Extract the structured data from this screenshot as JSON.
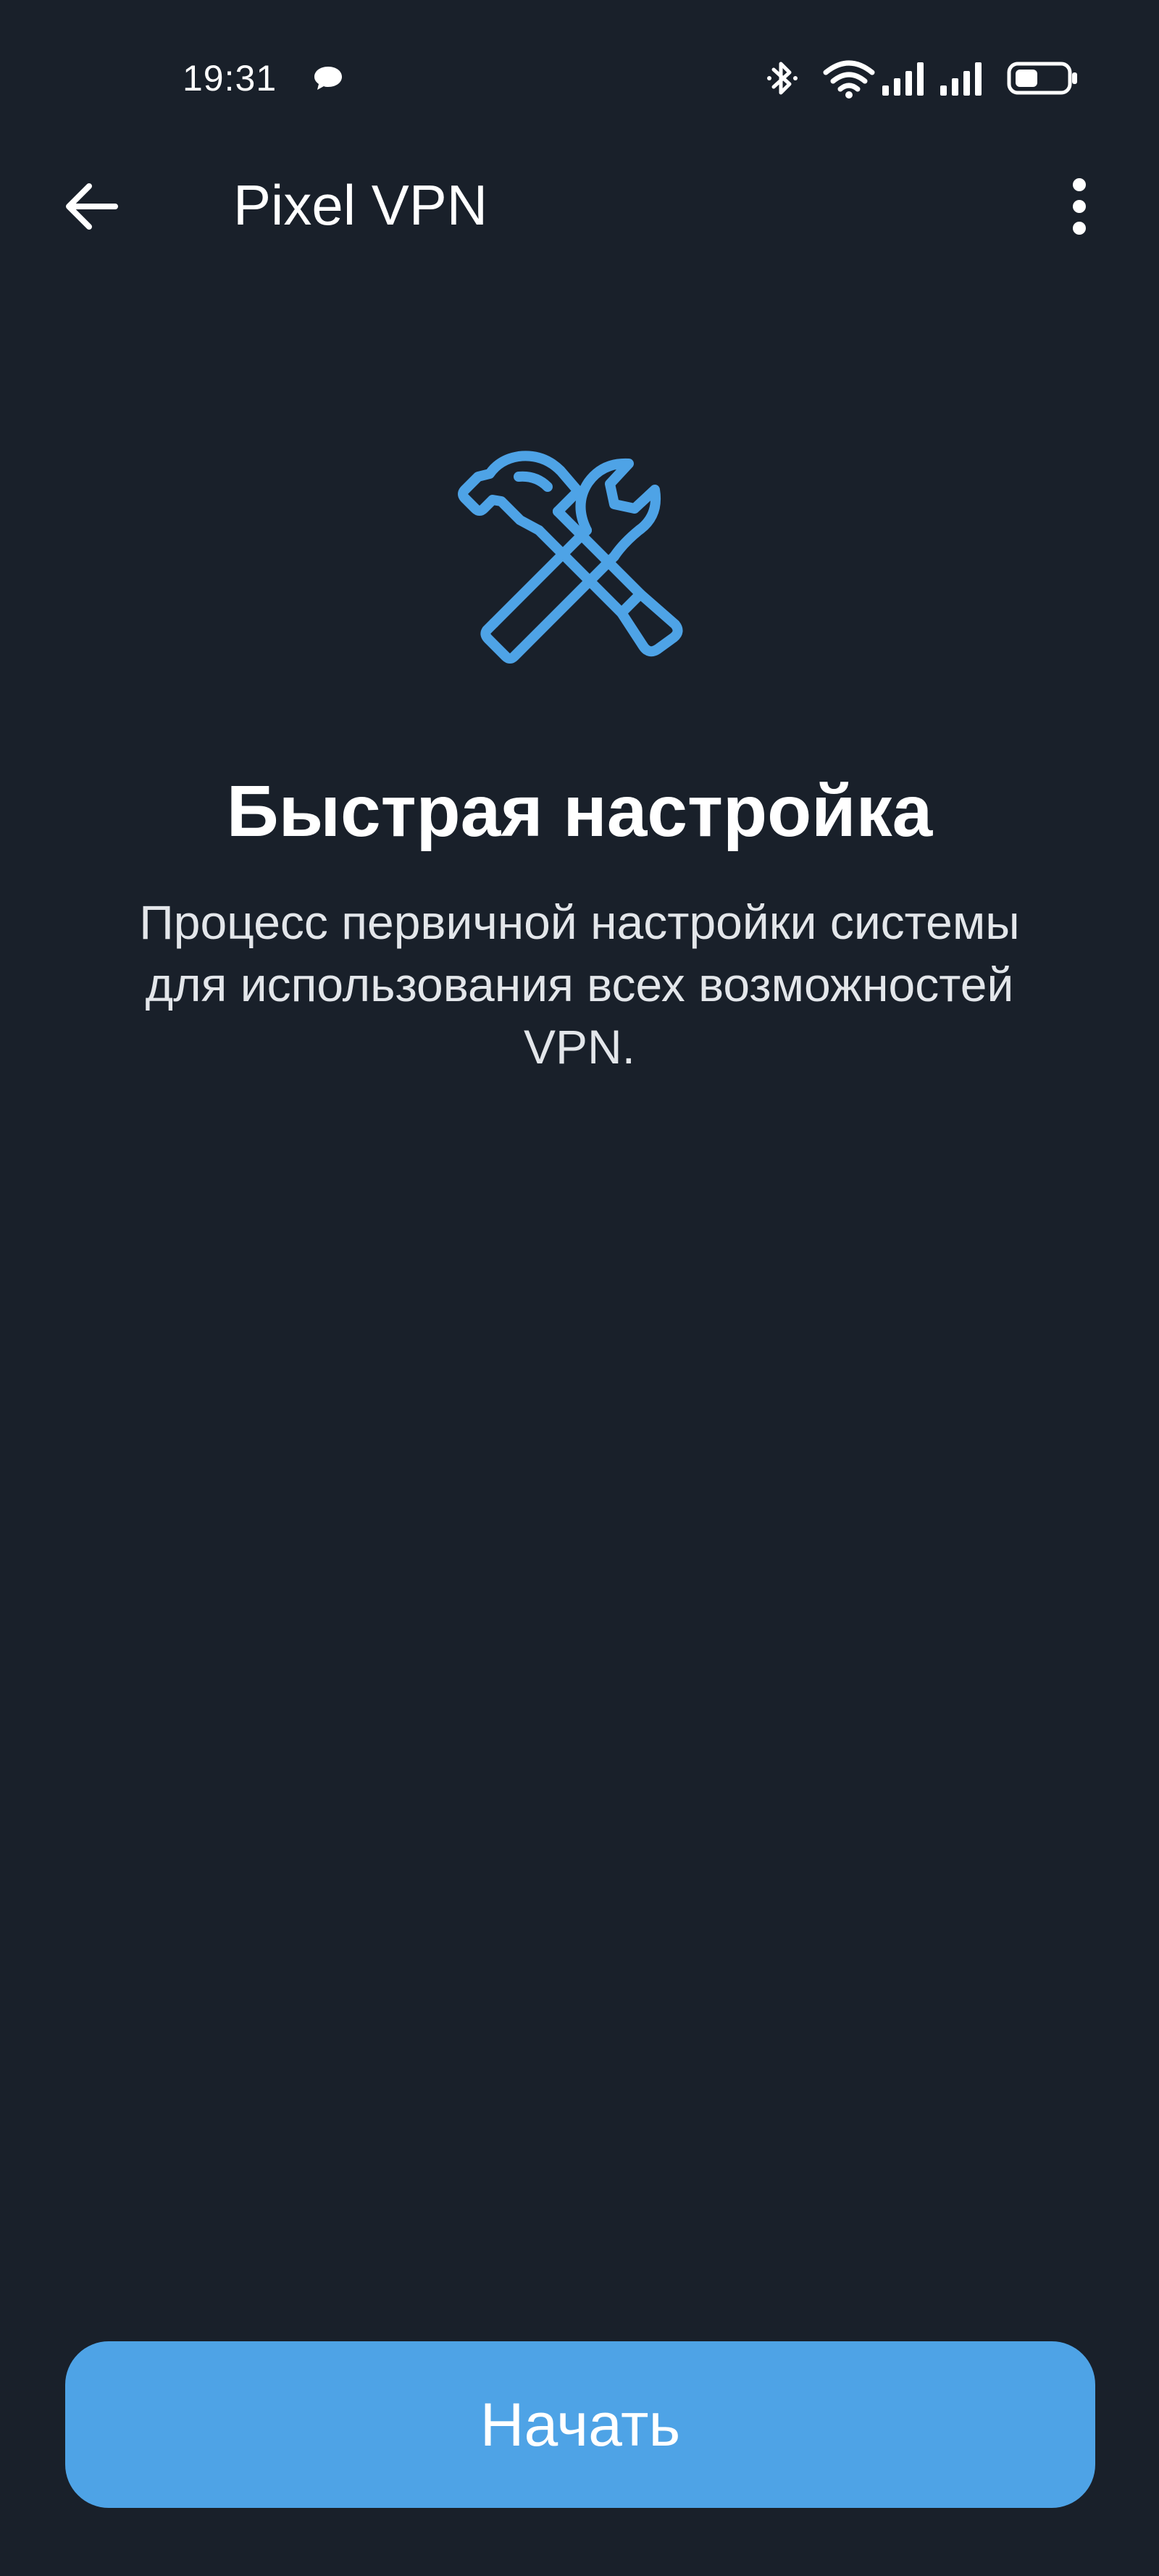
{
  "status_bar": {
    "time": "19:31",
    "icons": [
      "chat-icon",
      "bluetooth-icon",
      "wifi-icon",
      "signal-icon",
      "signal-icon",
      "battery-icon"
    ]
  },
  "app_bar": {
    "title": "Pixel VPN",
    "back_icon": "arrow-left-icon",
    "menu_icon": "more-vert-icon"
  },
  "content": {
    "icon": "hammer-wrench-icon",
    "title": "Быстрая настройка",
    "description": "Процесс первичной настройки системы для использования всех возможностей VPN."
  },
  "actions": {
    "start_label": "Начать"
  },
  "colors": {
    "background": "#19202A",
    "accent": "#4EA3E6",
    "text": "#FFFFFF"
  }
}
